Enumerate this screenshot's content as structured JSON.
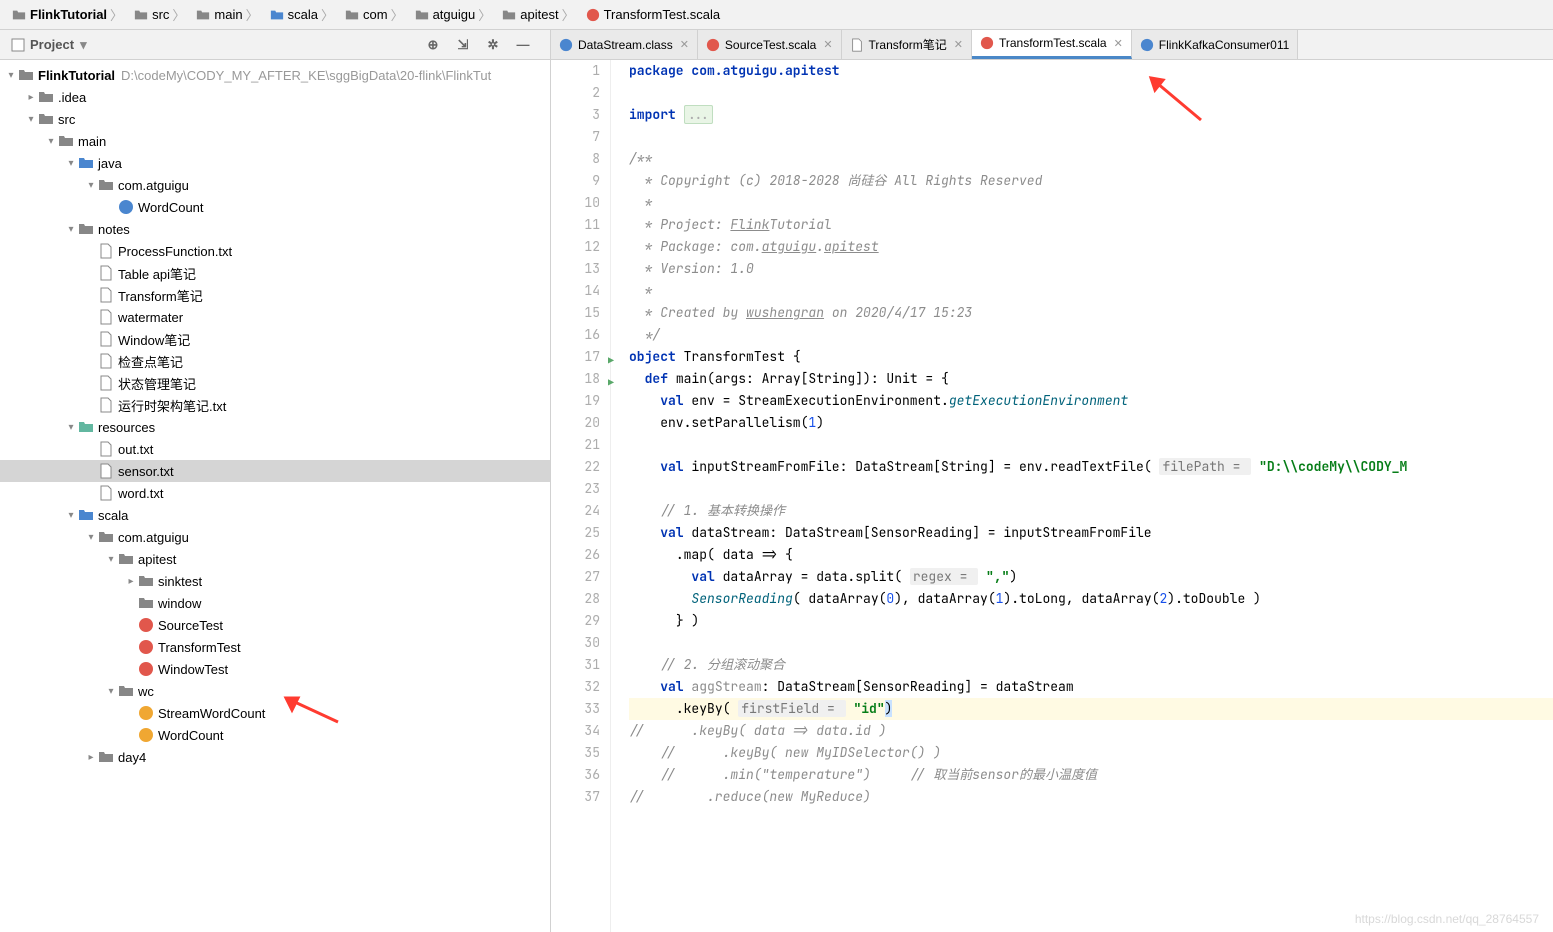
{
  "breadcrumbs": [
    "FlinkTutorial",
    "src",
    "main",
    "scala",
    "com",
    "atguigu",
    "apitest",
    "TransformTest.scala"
  ],
  "project_label": "Project",
  "project_root": {
    "name": "FlinkTutorial",
    "path": "D:\\codeMy\\CODY_MY_AFTER_KE\\sggBigData\\20-flink\\FlinkTut"
  },
  "tree": {
    "idea": ".idea",
    "src": "src",
    "main": "main",
    "java": "java",
    "pkg_java": "com.atguigu",
    "wordcount": "WordCount",
    "notes": "notes",
    "note_items": [
      "ProcessFunction.txt",
      "Table api笔记",
      "Transform笔记",
      "watermater",
      "Window笔记",
      "检查点笔记",
      "状态管理笔记",
      "运行时架构笔记.txt"
    ],
    "resources": "resources",
    "res_items": [
      "out.txt",
      "sensor.txt",
      "word.txt"
    ],
    "scala": "scala",
    "pkg_scala": "com.atguigu",
    "apitest": "apitest",
    "sinktest": "sinktest",
    "window": "window",
    "sourcetest": "SourceTest",
    "transformtest": "TransformTest",
    "windowtest": "WindowTest",
    "wc": "wc",
    "stream_wc": "StreamWordCount",
    "wc_obj": "WordCount",
    "day4": "day4"
  },
  "tabs": [
    {
      "label": "DataStream.class",
      "icon": "class",
      "active": false
    },
    {
      "label": "SourceTest.scala",
      "icon": "scala",
      "active": false
    },
    {
      "label": "Transform笔记",
      "icon": "file",
      "active": false
    },
    {
      "label": "TransformTest.scala",
      "icon": "scala",
      "active": true
    },
    {
      "label": "FlinkKafkaConsumer011",
      "icon": "class",
      "active": false
    }
  ],
  "gutter": [
    "1",
    "2",
    "3",
    "7",
    "8",
    "9",
    "10",
    "11",
    "12",
    "13",
    "14",
    "15",
    "16",
    "17",
    "18",
    "19",
    "20",
    "21",
    "22",
    "23",
    "24",
    "25",
    "26",
    "27",
    "28",
    "29",
    "30",
    "31",
    "32",
    "33",
    "34",
    "35",
    "36",
    "37"
  ],
  "run_lines": [
    "17",
    "18"
  ],
  "code": {
    "l1": "package com.atguigu.apitest",
    "l3a": "import ",
    "l3b": "...",
    "l8": "/**",
    "l9": "  * Copyright (c) 2018-2028 尚硅谷 All Rights Reserved",
    "l10": "  *",
    "l11a": "  * Project: ",
    "l11b": "Flink",
    "l11c": "Tutorial",
    "l12a": "  * Package: com.",
    "l12b": "atguigu",
    "l12c": ".",
    "l12d": "apitest",
    "l13": "  * Version: 1.0",
    "l14": "  *",
    "l15a": "  * Created by ",
    "l15b": "wushengran",
    "l15c": " on 2020/4/17 15:23",
    "l16": "  */",
    "l17a": "object",
    "l17b": " TransformTest {",
    "l18a": "def",
    "l18b": " main(args: Array[",
    "l18c": "String",
    "l18d": "]): Unit = {",
    "l19a": "val",
    "l19b": " env = StreamExecutionEnvironment.",
    "l19c": "getExecutionEnvironment",
    "l20a": "env.setParallelism(",
    "l20b": "1",
    "l20c": ")",
    "l22a": "val",
    "l22b": " inputStreamFromFile: DataStream[",
    "l22c": "String",
    "l22d": "] = env.readTextFile( ",
    "l22e": "filePath = ",
    "l22f": "\"D:\\\\codeMy\\\\CODY_M",
    "l24": "// 1. 基本转换操作",
    "l25a": "val",
    "l25b": " dataStream: DataStream[SensorReading] = inputStreamFromFile",
    "l26": ".map( data => {",
    "l27a": "val",
    "l27b": " dataArray = data.split( ",
    "l27c": "regex = ",
    "l27d": "\",\"",
    "l27e": ")",
    "l28a": "SensorReading",
    "l28b": "( dataArray(",
    "l28c": "0",
    "l28d": "), dataArray(",
    "l28e": "1",
    "l28f": ").toLong, dataArray(",
    "l28g": "2",
    "l28h": ").toDouble )",
    "l29": "} )",
    "l31": "// 2. 分组滚动聚合",
    "l32a": "val",
    "l32b": " ",
    "l32c": "aggStream",
    "l32d": ": DataStream[SensorReading] = dataStream",
    "l33a": ".keyBy( ",
    "l33b": "firstField = ",
    "l33c": "\"id\"",
    "l33d": ")",
    "l34": "//      .keyBy( data => data.id )",
    "l35": "//      .keyBy( new MyIDSelector() )",
    "l36": "//      .min(\"temperature\")     // 取当前sensor的最小温度值",
    "l37": "//        .reduce(new MyReduce)"
  },
  "watermark": "https://blog.csdn.net/qq_28764557"
}
